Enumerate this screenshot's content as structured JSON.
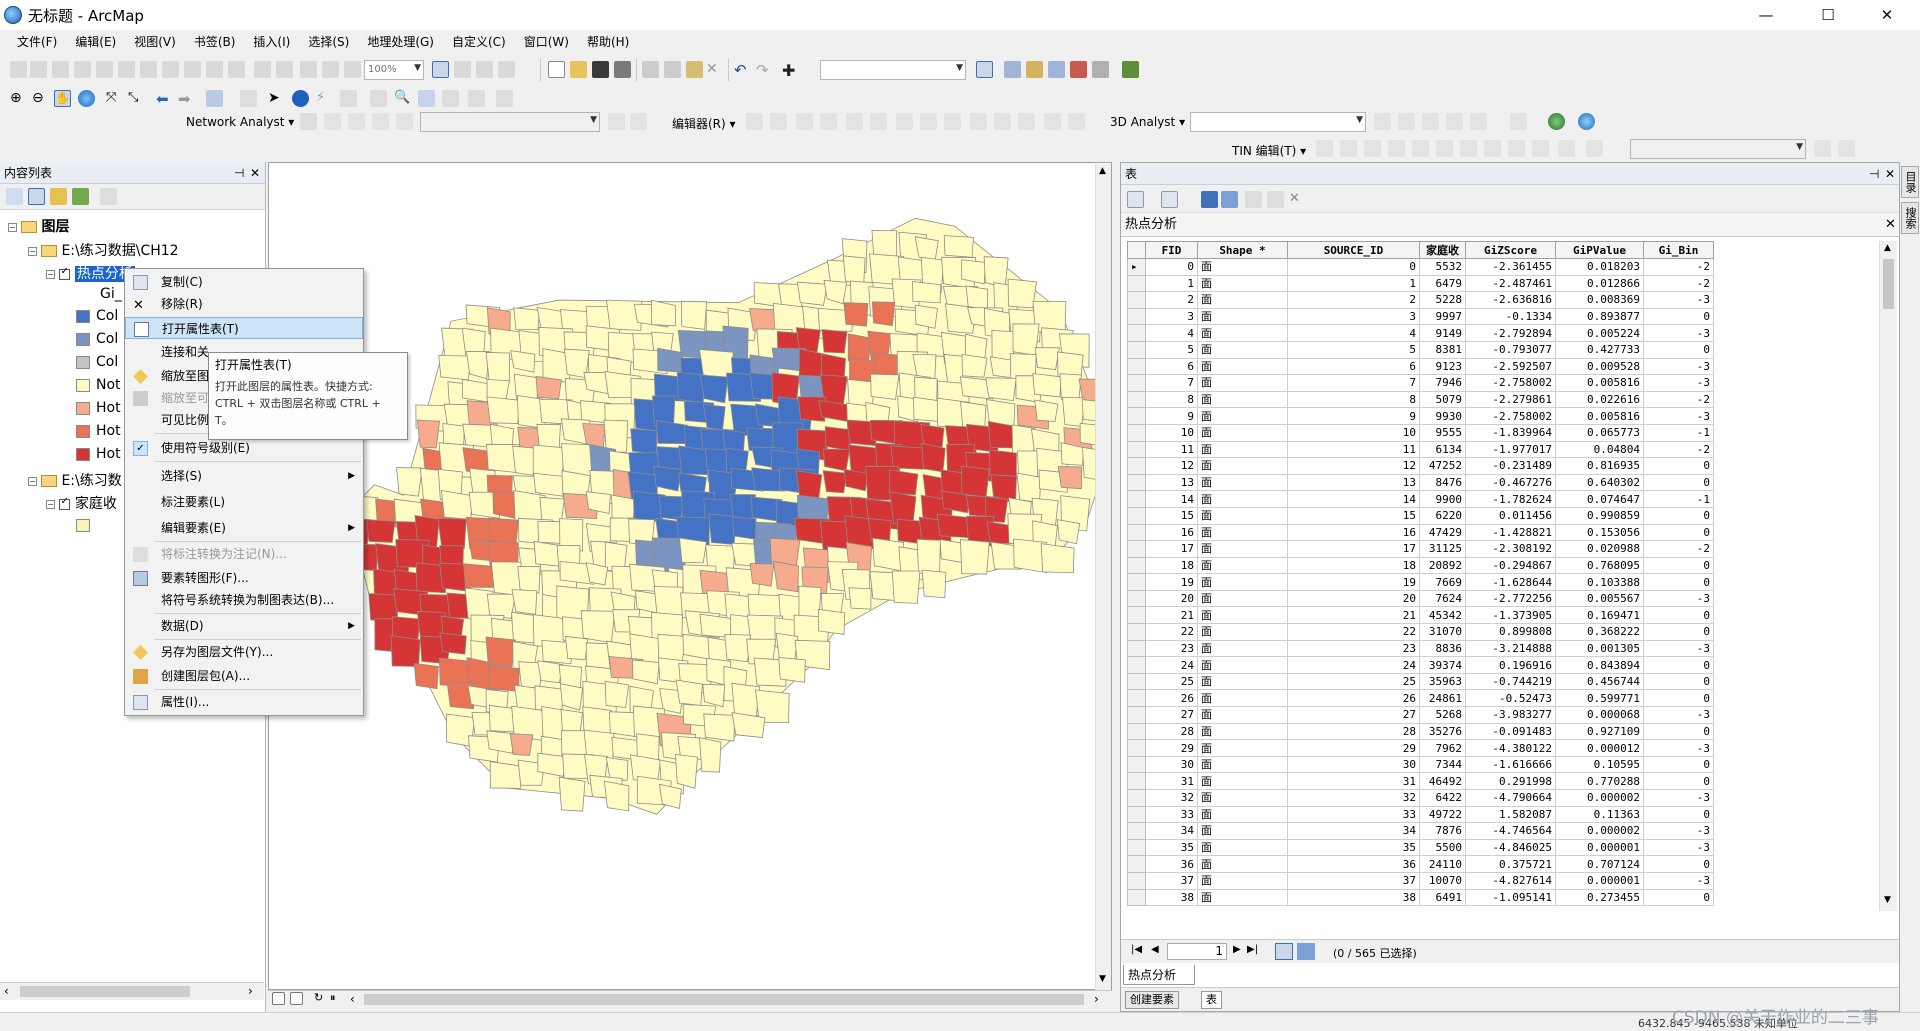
{
  "window": {
    "title": "无标题 - ArcMap",
    "min": "—",
    "max": "☐",
    "close": "✕"
  },
  "menu": [
    "文件(F)",
    "编辑(E)",
    "视图(V)",
    "书签(B)",
    "插入(I)",
    "选择(S)",
    "地理处理(G)",
    "自定义(C)",
    "窗口(W)",
    "帮助(H)"
  ],
  "toolbar": {
    "zoom_level": "100%",
    "network_analyst": "Network Analyst ▾",
    "editor": "编辑器(R) ▾",
    "analyst3d": "3D Analyst ▾",
    "tin_edit": "TIN 编辑(T) ▾"
  },
  "toc": {
    "title": "内容列表",
    "pin": "⊣",
    "close": "✕",
    "root": "图层",
    "group1": "E:\\练习数据\\CH12",
    "layer_selected": "热点分析",
    "field_label": "Gi_",
    "legend": [
      "Col",
      "Col",
      "Col",
      "Not",
      "Hot",
      "Hot",
      "Hot"
    ],
    "legend_colors": [
      "#4472c4",
      "#7b95c0",
      "#c0c5c0",
      "#fefbc3",
      "#f6ab8c",
      "#ea7255",
      "#d63535"
    ],
    "group2": "E:\\练习数",
    "layer2": "家庭收",
    "layer2_color": "#f6f4b6"
  },
  "context_menu": {
    "items": [
      {
        "label": "复制(C)",
        "disabled": false,
        "sub": false
      },
      {
        "label": "移除(R)",
        "disabled": false,
        "sub": false
      },
      {
        "label": "打开属性表(T)",
        "disabled": false,
        "sub": false
      },
      {
        "label": "连接和关",
        "disabled": false,
        "sub": false
      },
      {
        "label": "缩放至图",
        "disabled": false,
        "sub": false
      },
      {
        "label": "缩放至可",
        "disabled": true,
        "sub": false
      },
      {
        "label": "可见比例",
        "disabled": false,
        "sub": false
      },
      {
        "label": "使用符号级别(E)",
        "disabled": false,
        "sub": false
      },
      {
        "label": "选择(S)",
        "disabled": false,
        "sub": true
      },
      {
        "label": "标注要素(L)",
        "disabled": false,
        "sub": false
      },
      {
        "label": "编辑要素(E)",
        "disabled": false,
        "sub": true
      },
      {
        "label": "将标注转换为注记(N)...",
        "disabled": true,
        "sub": false
      },
      {
        "label": "要素转图形(F)...",
        "disabled": false,
        "sub": false
      },
      {
        "label": "将符号系统转换为制图表达(B)...",
        "disabled": false,
        "sub": false
      },
      {
        "label": "数据(D)",
        "disabled": false,
        "sub": true
      },
      {
        "label": "另存为图层文件(Y)...",
        "disabled": false,
        "sub": false
      },
      {
        "label": "创建图层包(A)...",
        "disabled": false,
        "sub": false
      },
      {
        "label": "属性(I)...",
        "disabled": false,
        "sub": false
      }
    ]
  },
  "tooltip": {
    "title": "打开属性表(T)",
    "body": "打开此图层的属性表。快捷方式: CTRL + 双击图层名称或 CTRL + T。"
  },
  "table_window": {
    "title": "表",
    "pin": "⊣",
    "close": "✕",
    "layer_title": "热点分析",
    "columns": [
      "FID",
      "Shape *",
      "SOURCE_ID",
      "家庭收",
      "GiZScore",
      "GiPValue",
      "Gi_Bin"
    ],
    "rows": [
      [
        "0",
        "面",
        "0",
        "5532",
        "-2.361455",
        "0.018203",
        "-2"
      ],
      [
        "1",
        "面",
        "1",
        "6479",
        "-2.487461",
        "0.012866",
        "-2"
      ],
      [
        "2",
        "面",
        "2",
        "5228",
        "-2.636816",
        "0.008369",
        "-3"
      ],
      [
        "3",
        "面",
        "3",
        "9997",
        "-0.1334",
        "0.893877",
        "0"
      ],
      [
        "4",
        "面",
        "4",
        "9149",
        "-2.792894",
        "0.005224",
        "-3"
      ],
      [
        "5",
        "面",
        "5",
        "8381",
        "-0.793077",
        "0.427733",
        "0"
      ],
      [
        "6",
        "面",
        "6",
        "9123",
        "-2.592507",
        "0.009528",
        "-3"
      ],
      [
        "7",
        "面",
        "7",
        "7946",
        "-2.758002",
        "0.005816",
        "-3"
      ],
      [
        "8",
        "面",
        "8",
        "5079",
        "-2.279861",
        "0.022616",
        "-2"
      ],
      [
        "9",
        "面",
        "9",
        "9930",
        "-2.758002",
        "0.005816",
        "-3"
      ],
      [
        "10",
        "面",
        "10",
        "9555",
        "-1.839964",
        "0.065773",
        "-1"
      ],
      [
        "11",
        "面",
        "11",
        "6134",
        "-1.977017",
        "0.04804",
        "-2"
      ],
      [
        "12",
        "面",
        "12",
        "47252",
        "-0.231489",
        "0.816935",
        "0"
      ],
      [
        "13",
        "面",
        "13",
        "8476",
        "-0.467276",
        "0.640302",
        "0"
      ],
      [
        "14",
        "面",
        "14",
        "9900",
        "-1.782624",
        "0.074647",
        "-1"
      ],
      [
        "15",
        "面",
        "15",
        "6220",
        "0.011456",
        "0.990859",
        "0"
      ],
      [
        "16",
        "面",
        "16",
        "47429",
        "-1.428821",
        "0.153056",
        "0"
      ],
      [
        "17",
        "面",
        "17",
        "31125",
        "-2.308192",
        "0.020988",
        "-2"
      ],
      [
        "18",
        "面",
        "18",
        "20892",
        "-0.294867",
        "0.768095",
        "0"
      ],
      [
        "19",
        "面",
        "19",
        "7669",
        "-1.628644",
        "0.103388",
        "0"
      ],
      [
        "20",
        "面",
        "20",
        "7624",
        "-2.772256",
        "0.005567",
        "-3"
      ],
      [
        "21",
        "面",
        "21",
        "45342",
        "-1.373905",
        "0.169471",
        "0"
      ],
      [
        "22",
        "面",
        "22",
        "31070",
        "0.899808",
        "0.368222",
        "0"
      ],
      [
        "23",
        "面",
        "23",
        "8836",
        "-3.214888",
        "0.001305",
        "-3"
      ],
      [
        "24",
        "面",
        "24",
        "39374",
        "0.196916",
        "0.843894",
        "0"
      ],
      [
        "25",
        "面",
        "25",
        "35963",
        "-0.744219",
        "0.456744",
        "0"
      ],
      [
        "26",
        "面",
        "26",
        "24861",
        "-0.52473",
        "0.599771",
        "0"
      ],
      [
        "27",
        "面",
        "27",
        "5268",
        "-3.983277",
        "0.000068",
        "-3"
      ],
      [
        "28",
        "面",
        "28",
        "35276",
        "-0.091483",
        "0.927109",
        "0"
      ],
      [
        "29",
        "面",
        "29",
        "7962",
        "-4.380122",
        "0.000012",
        "-3"
      ],
      [
        "30",
        "面",
        "30",
        "7344",
        "-1.616666",
        "0.10595",
        "0"
      ],
      [
        "31",
        "面",
        "31",
        "46492",
        "0.291998",
        "0.770288",
        "0"
      ],
      [
        "32",
        "面",
        "32",
        "6422",
        "-4.790664",
        "0.000002",
        "-3"
      ],
      [
        "33",
        "面",
        "33",
        "49722",
        "1.582087",
        "0.11363",
        "0"
      ],
      [
        "34",
        "面",
        "34",
        "7876",
        "-4.746564",
        "0.000002",
        "-3"
      ],
      [
        "35",
        "面",
        "35",
        "5500",
        "-4.846025",
        "0.000001",
        "-3"
      ],
      [
        "36",
        "面",
        "36",
        "24110",
        "0.375721",
        "0.707124",
        "0"
      ],
      [
        "37",
        "面",
        "37",
        "10070",
        "-4.827614",
        "0.000001",
        "-3"
      ],
      [
        "38",
        "面",
        "38",
        "6491",
        "-1.095141",
        "0.273455",
        "0"
      ]
    ],
    "nav_record": "1",
    "selection_status": "(0 / 565 已选择)",
    "bottom_tab": "热点分析",
    "tab_features": "创建要素",
    "tab_table": "表"
  },
  "side_tabs": [
    "目录",
    "搜索"
  ],
  "status": {
    "coords": "6432.845  -9465.538 未知单位",
    "watermark": "CSDN @关于作业的二三事"
  },
  "map_colors": {
    "cold99": "#4472c4",
    "cold95": "#7b95c0",
    "notsig": "#fefbc3",
    "hot90": "#f6ab8c",
    "hot95": "#ea7255",
    "hot99": "#d63535",
    "outline": "#8c8c8c"
  }
}
